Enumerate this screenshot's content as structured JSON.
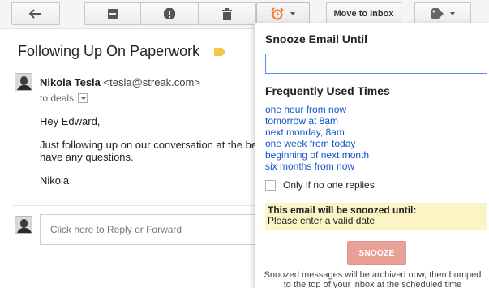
{
  "toolbar": {
    "back_icon": "arrow-left-icon",
    "archive_icon": "archive-icon",
    "spam_icon": "report-spam-icon",
    "delete_icon": "trash-icon",
    "snooze_icon": "alarm-clock-icon",
    "move_to_inbox_label": "Move to Inbox",
    "labels_icon": "tag-icon",
    "snooze_color": "#f07a2b"
  },
  "email": {
    "subject": "Following Up On Paperwork",
    "label_color": "#f6c54b",
    "sender_name": "Nikola Tesla",
    "sender_email": "<tesla@streak.com>",
    "to_line": "to deals",
    "greeting": "Hey Edward,",
    "body_line1": "Just following up on our conversation at the beg",
    "body_line2": "have any questions.",
    "signature": "Nikola"
  },
  "reply": {
    "prefix": "Click here to",
    "reply_link": "Reply",
    "or": "or",
    "forward_link": "Forward"
  },
  "snooze_panel": {
    "title": "Snooze Email Until",
    "input_value": "",
    "frequent_title": "Frequently Used Times",
    "times": [
      "one hour from now",
      "tomorrow at 8am",
      "next monday, 8am",
      "one week from today",
      "beginning of next month",
      "six months from now"
    ],
    "only_if_no_reply_label": "Only if no one replies",
    "notice_heading": "This email will be snoozed until:",
    "notice_value": "Please enter a valid date",
    "snooze_button": "SNOOZE",
    "footer_line1": "Snoozed messages will be archived now, then bumped",
    "footer_line2": "to the top of your inbox at the scheduled time",
    "link_color": "#1155cc",
    "button_color": "#e8a196"
  }
}
